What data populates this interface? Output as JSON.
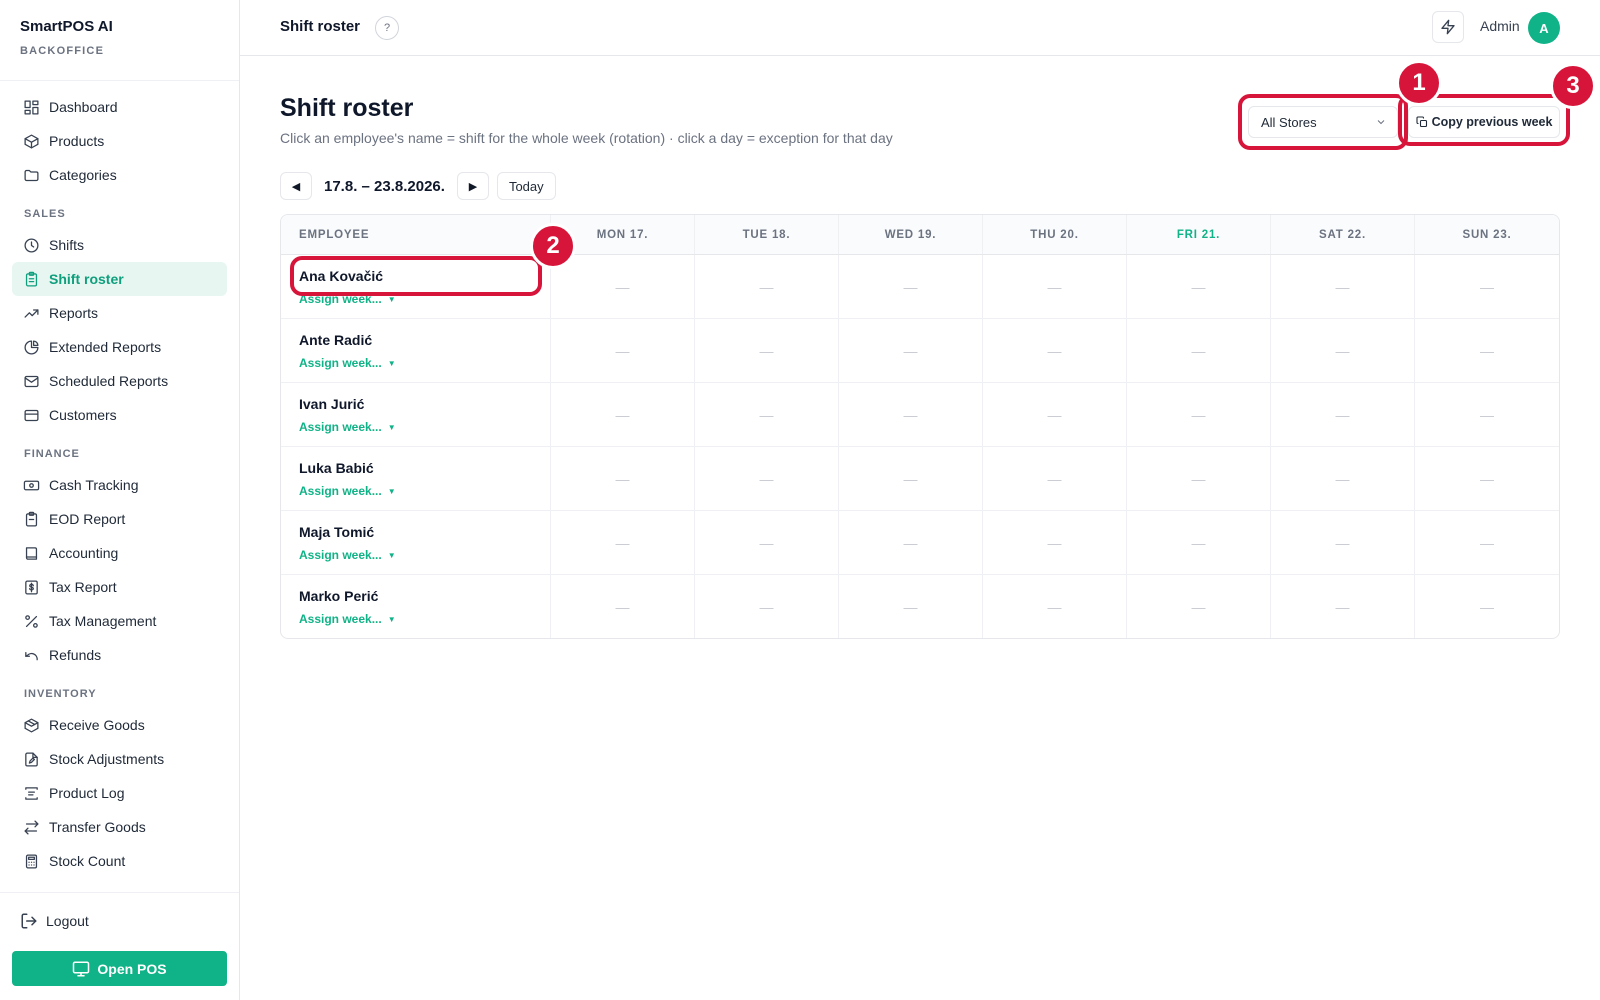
{
  "brand": {
    "name": "SmartPOS AI",
    "subtitle": "BACKOFFICE"
  },
  "sidebar": {
    "items": [
      {
        "label": "Dashboard",
        "icon": "dashboard-icon",
        "active": false
      },
      {
        "label": "Products",
        "icon": "box-icon",
        "active": false
      },
      {
        "label": "Categories",
        "icon": "folder-icon",
        "active": false
      }
    ],
    "sections": [
      {
        "title": "SALES",
        "items": [
          {
            "label": "Shifts",
            "icon": "clock-icon",
            "active": false
          },
          {
            "label": "Shift roster",
            "icon": "roster-icon",
            "active": true
          },
          {
            "label": "Reports",
            "icon": "trend-icon",
            "active": false
          },
          {
            "label": "Extended Reports",
            "icon": "pie-icon",
            "active": false
          },
          {
            "label": "Scheduled Reports",
            "icon": "mail-icon",
            "active": false
          },
          {
            "label": "Customers",
            "icon": "card-icon",
            "active": false
          }
        ]
      },
      {
        "title": "FINANCE",
        "items": [
          {
            "label": "Cash Tracking",
            "icon": "cash-icon",
            "active": false
          },
          {
            "label": "EOD Report",
            "icon": "clipboard-icon",
            "active": false
          },
          {
            "label": "Accounting",
            "icon": "book-icon",
            "active": false
          },
          {
            "label": "Tax Report",
            "icon": "dollar-doc-icon",
            "active": false
          },
          {
            "label": "Tax Management",
            "icon": "percent-icon",
            "active": false
          },
          {
            "label": "Refunds",
            "icon": "undo-icon",
            "active": false
          }
        ]
      },
      {
        "title": "INVENTORY",
        "items": [
          {
            "label": "Receive Goods",
            "icon": "package-icon",
            "active": false
          },
          {
            "label": "Stock Adjustments",
            "icon": "file-edit-icon",
            "active": false
          },
          {
            "label": "Product Log",
            "icon": "log-icon",
            "active": false
          },
          {
            "label": "Transfer Goods",
            "icon": "transfer-icon",
            "active": false
          },
          {
            "label": "Stock Count",
            "icon": "calculator-icon",
            "active": false
          }
        ]
      }
    ],
    "logout": "Logout",
    "open_pos": "Open POS"
  },
  "topbar": {
    "title": "Shift roster",
    "help": "?",
    "user": "Admin",
    "avatar": "A"
  },
  "main": {
    "title": "Shift roster",
    "subtitle": "Click an employee's name = shift for the whole week (rotation) · click a day = exception for that day",
    "store_select": "All Stores",
    "copy_button": "Copy previous week",
    "week_range": "17.8. – 23.8.2026.",
    "prev": "◀",
    "next": "▶",
    "today": "Today"
  },
  "roster": {
    "employee_header": "EMPLOYEE",
    "days": [
      "MON 17.",
      "TUE 18.",
      "WED 19.",
      "THU 20.",
      "FRI 21.",
      "SAT 22.",
      "SUN 23."
    ],
    "today_index": 4,
    "empty_mark": "—",
    "assign_label": "Assign week...",
    "employees": [
      "Ana Kovačić",
      "Ante Radić",
      "Ivan Jurić",
      "Luka Babić",
      "Maja Tomić",
      "Marko Perić"
    ],
    "accent_color": "#10b387"
  },
  "annotations": [
    "1",
    "2",
    "3"
  ]
}
